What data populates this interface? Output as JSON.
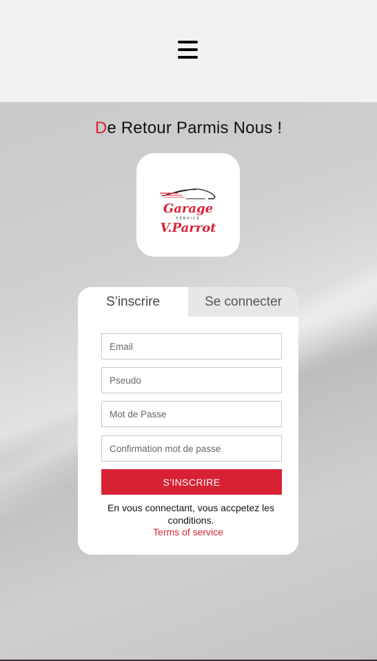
{
  "header": {
    "menu_icon": "hamburger-menu-icon"
  },
  "hero": {
    "title_first_letter": "D",
    "title_rest": "e Retour Parmis Nous !",
    "logo": {
      "line1": "Garage",
      "line2": "SERVICE",
      "line3": "V.Parrot",
      "color": "#d82234"
    }
  },
  "auth": {
    "tabs": [
      {
        "label": "S’inscrire",
        "active": true
      },
      {
        "label": "Se connecter",
        "active": false
      }
    ],
    "fields": [
      {
        "placeholder": "Email",
        "value": ""
      },
      {
        "placeholder": "Pseudo",
        "value": ""
      },
      {
        "placeholder": "Mot de Passe",
        "value": ""
      },
      {
        "placeholder": "Confirmation mot de passe",
        "value": ""
      }
    ],
    "submit_label": "S'INSCRIRE",
    "terms_text": "En vous connectant, vous accpetez les conditions.",
    "terms_link": "Terms of service"
  },
  "colors": {
    "accent": "#d82234",
    "header_bg": "#f2f2f2",
    "inactive_tab_bg": "#e6e7e8"
  }
}
